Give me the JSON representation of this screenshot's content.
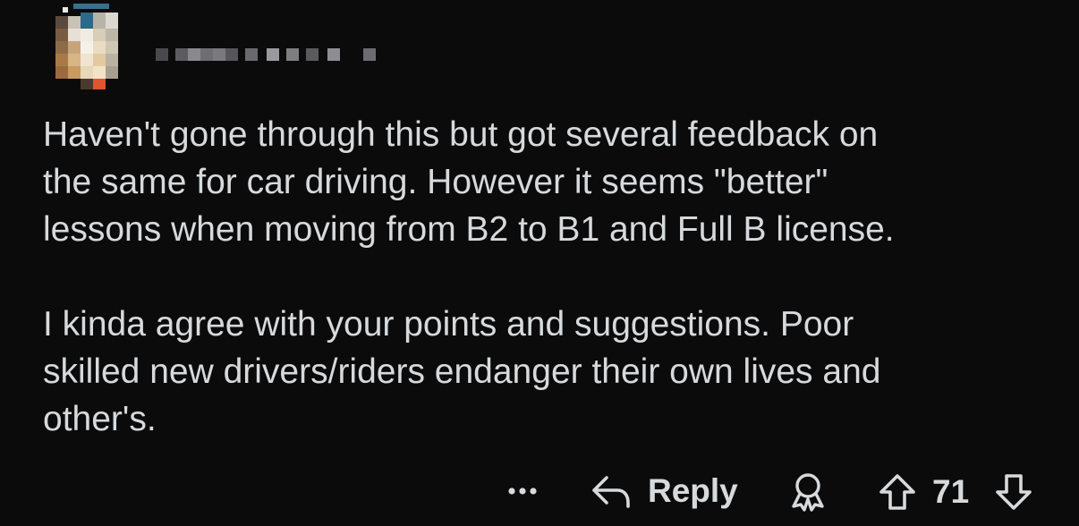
{
  "comment": {
    "username": "",
    "paragraphs": [
      [
        "Haven't gone through this but got several feedback on",
        "the same for car driving. However it seems \"better\"",
        "lessons when moving from B2 to B1 and Full B license."
      ],
      [
        "I kinda agree with your points and suggestions. Poor",
        "skilled new drivers/riders endanger their own lives and",
        "other's."
      ]
    ]
  },
  "actions": {
    "more_label": "•••",
    "reply_label": "Reply",
    "score": "71"
  },
  "colors": {
    "background": "#0b0b0c",
    "text": "#d7dadc"
  },
  "icons": {
    "more": "more-options-icon",
    "reply": "reply-arrow-icon",
    "award": "award-icon",
    "upvote": "upvote-arrow-icon",
    "downvote": "downvote-arrow-icon"
  }
}
